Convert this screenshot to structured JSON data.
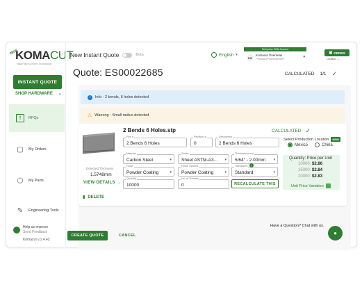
{
  "logo": {
    "prefix": "KOMA",
    "suffix": "CUT",
    "new_tag": "NEW",
    "tagline": "SHEET METAL PARTS ON DEMAND"
  },
  "sidebar": {
    "instant_quote": "INSTANT QUOTE",
    "shop_hardware": "SHOP HARDWARE",
    "items": [
      {
        "label": "RFQs",
        "icon": "rfq-icon"
      },
      {
        "label": "My Orders",
        "icon": "box-icon"
      },
      {
        "label": "My Parts",
        "icon": "parts-icon"
      },
      {
        "label": "Engineering Tools",
        "icon": "tools-icon"
      }
    ],
    "help_line1": "Help us improve",
    "help_line2": "Send Feedback",
    "version": "Komacut v.1.4.42"
  },
  "header": {
    "title": "New Instant Quote",
    "beta": "Beta",
    "language": "English",
    "account_banner": "Enterprise OEM Account",
    "avatar": "KO",
    "account_name": "Komacut Overseas",
    "account_sub": "**Komacut**International**",
    "order": "ORDER",
    "location": "Location: ---"
  },
  "quote": {
    "label": "Quote:",
    "id": "ES00022685",
    "status": "CALCULATED",
    "count": "1/1"
  },
  "alerts": {
    "info": "Info - 2 bends, 6 holes detected",
    "warning": "Warning - Small radius detected"
  },
  "part": {
    "filename": "2 Bends 6 Holes.stp",
    "status": "CALCULATED",
    "thickness_label": "Detected Thickness",
    "thickness_value": "1.5748mm",
    "view_details": "VIEW DETAILS",
    "delete": "DELETE",
    "fields": {
      "part_no": {
        "label": "Part #",
        "value": "2 Bends 6 Holes"
      },
      "revision": {
        "label": "Revision #",
        "value": "0"
      },
      "description": {
        "label": "Description",
        "value": "2 Bends 6 Holes"
      },
      "material": {
        "label": "Material",
        "value": "Carbon Steel"
      },
      "series": {
        "label": "Series",
        "value": "Sheet ASTM-A3..."
      },
      "thickness": {
        "label": "Thickness (mm)",
        "value": "5/64\" - 2.00mm"
      },
      "finish": {
        "label": "Finish",
        "value": "Powder Coating"
      },
      "finish_options": {
        "label": "Finish Options",
        "value": "Powder Coating"
      },
      "tolerances": {
        "label": "Tolerances",
        "value": "Standard"
      },
      "quantity": {
        "label": "Quantity",
        "value": "10000"
      },
      "threads": {
        "label": "No. of Threads",
        "value": "0"
      }
    },
    "recalculate": "RECALCULATE THIS",
    "production_location": "Select Production Location",
    "new_badge": "NEW",
    "locations": [
      "Mexico",
      "China"
    ],
    "selected_location": "Mexico",
    "qty_title": "Quantity: Price per Unit",
    "prices": [
      {
        "qty": "10000:",
        "price": "$2.86"
      },
      {
        "qty": "15000:",
        "price": "$2.84"
      },
      {
        "qty": "20000:",
        "price": "$2.83"
      }
    ],
    "unit_price_variation": "Unit Price Variation"
  },
  "footer": {
    "question": "Have a Question? Chat with us.",
    "create": "CREATE QUOTE",
    "cancel": "CANCEL"
  },
  "colors": {
    "brand": "#2e7d32",
    "info_bg": "#dfeefb",
    "warning_bg": "#fbf3e3",
    "active_nav": "#e6f4e6"
  }
}
